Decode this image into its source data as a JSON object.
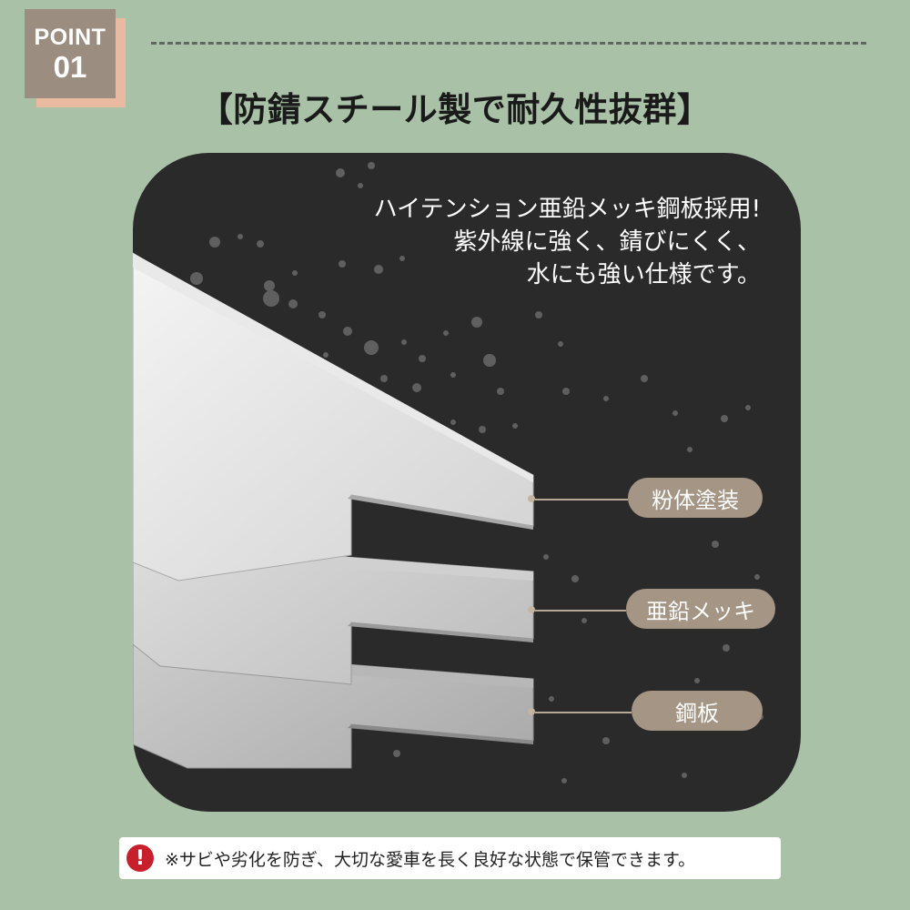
{
  "badge": {
    "word": "POINT",
    "number": "01"
  },
  "title": "【防錆スチール製で耐久性抜群】",
  "description": {
    "lines": [
      "ハイテンション亜鉛メッキ鋼板採用!",
      "紫外線に強く、錆びにくく、",
      "水にも強い仕様です。"
    ]
  },
  "layers": [
    {
      "label": "粉体塗装"
    },
    {
      "label": "亜鉛メッキ"
    },
    {
      "label": "鋼板"
    }
  ],
  "note": {
    "icon": "exclamation-icon",
    "text": "※サビや劣化を防ぎ、大切な愛車を長く良好な状態で保管できます。"
  },
  "colors": {
    "background": "#a9c2a7",
    "badge": "#9b8e80",
    "badge_shadow": "#e9b9a0",
    "panel": "#2a2a2a",
    "label_pill": "#a49585",
    "alert": "#c8202a"
  }
}
